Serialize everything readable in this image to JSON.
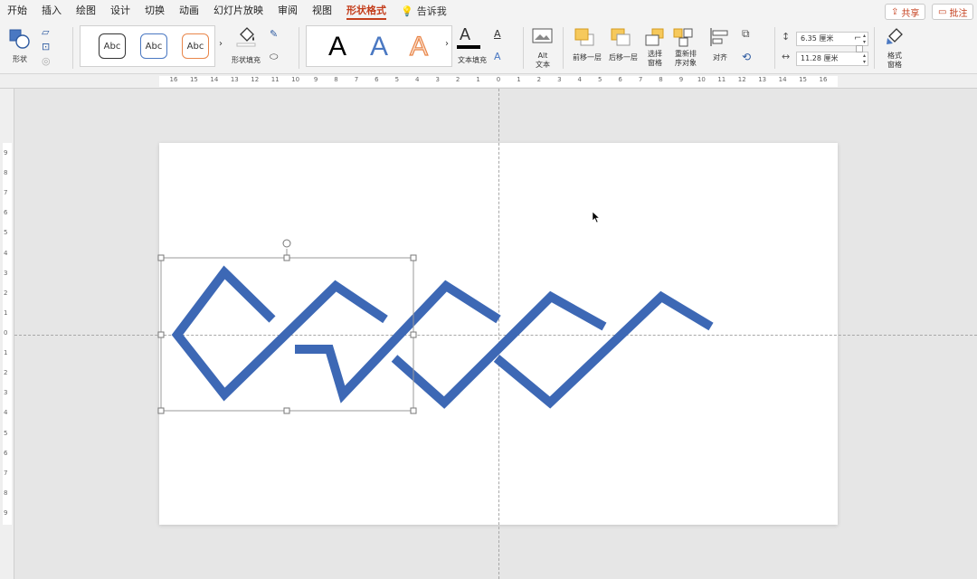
{
  "menu": {
    "tabs": [
      "开始",
      "插入",
      "绘图",
      "设计",
      "切换",
      "动画",
      "幻灯片放映",
      "审阅",
      "视图",
      "形状格式"
    ],
    "active_tab": "形状格式",
    "tell_me": "告诉我",
    "share": "共享",
    "comment": "批注"
  },
  "ribbon": {
    "shape_label": "形状",
    "style_samples": [
      "Abc",
      "Abc",
      "Abc"
    ],
    "shape_fill_label": "形状填充",
    "wordart_letters": [
      "A",
      "A",
      "A"
    ],
    "text_fill_label": "文本填充",
    "alt_text_label": "Alt\n文本",
    "bring_forward": "前移一层",
    "send_backward": "后移一层",
    "selection_pane": "选择\n窗格",
    "reorder_objects": "重新排\n序对象",
    "align": "对齐",
    "height_value": "6.35 厘米",
    "width_value": "11.28 厘米",
    "format_pane": "格式\n窗格"
  },
  "ruler": {
    "h_ticks": [
      "16",
      "15",
      "14",
      "13",
      "12",
      "11",
      "10",
      "9",
      "8",
      "7",
      "6",
      "5",
      "4",
      "3",
      "2",
      "1",
      "0",
      "1",
      "2",
      "3",
      "4",
      "5",
      "6",
      "7",
      "8",
      "9",
      "10",
      "11",
      "12",
      "13",
      "14",
      "15",
      "16"
    ],
    "v_ticks": [
      "9",
      "8",
      "7",
      "6",
      "5",
      "4",
      "3",
      "2",
      "1",
      "0",
      "1",
      "2",
      "3",
      "4",
      "5",
      "6",
      "7",
      "8",
      "9"
    ]
  },
  "colors": {
    "accent": "#c43e1c",
    "shape_blue": "#3d68b5",
    "style_blue": "#4a78c2",
    "style_orange": "#e9864a"
  }
}
